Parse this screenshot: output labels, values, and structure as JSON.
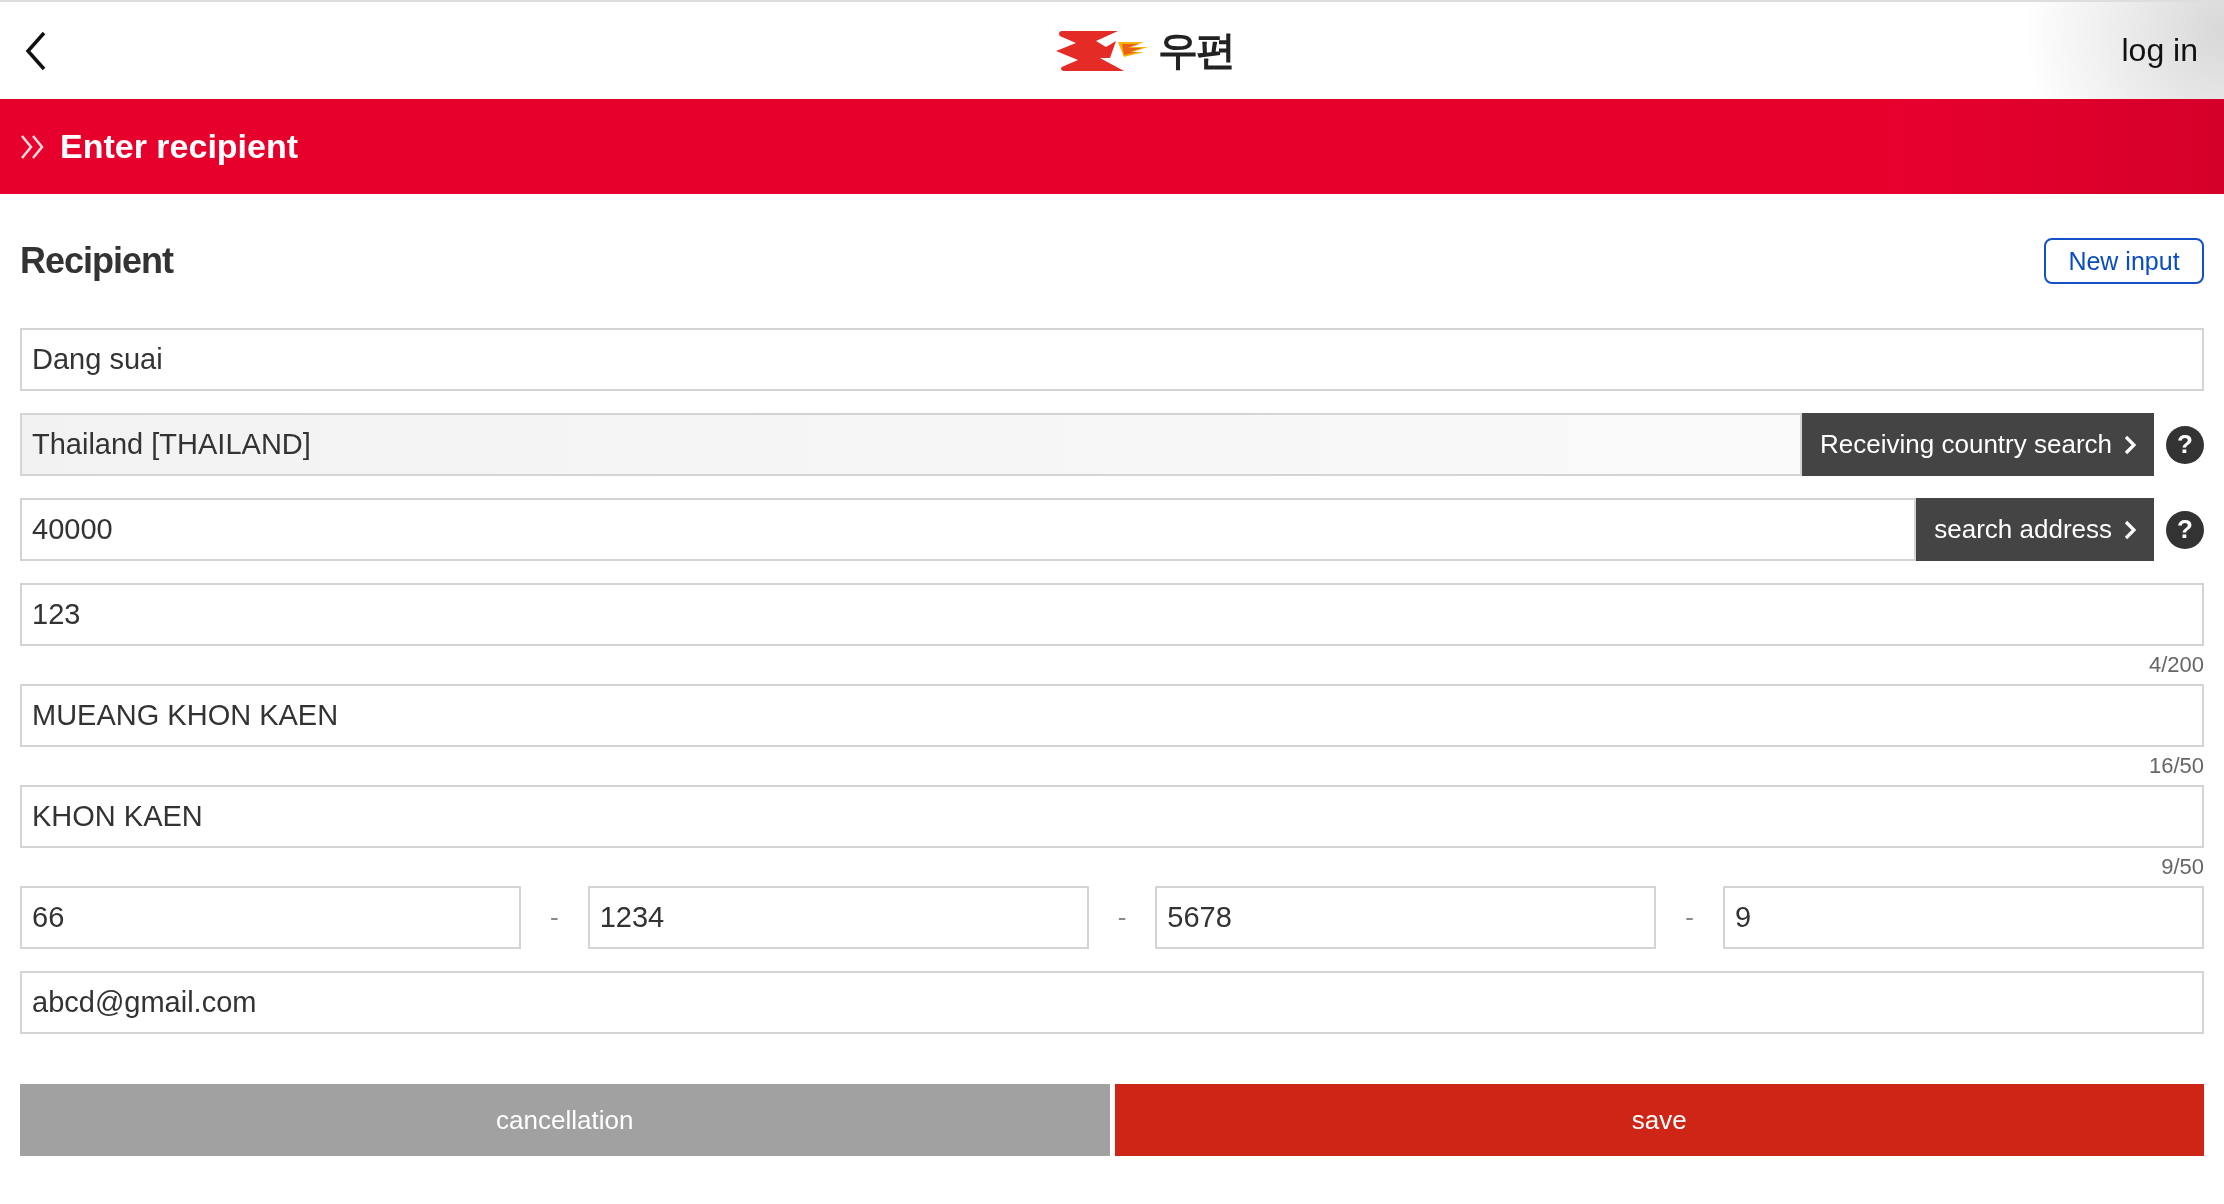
{
  "header": {
    "logo_text": "우편",
    "login": "log in"
  },
  "title_bar": {
    "title": "Enter recipient"
  },
  "section": {
    "title": "Recipient",
    "new_input": "New input"
  },
  "fields": [
    {
      "kind": "text",
      "value": "Dang suai"
    },
    {
      "kind": "search",
      "value": "Thailand [THAILAND]",
      "readonly": true,
      "button": "Receiving country search",
      "help": "?"
    },
    {
      "kind": "search",
      "value": "40000",
      "readonly": false,
      "button": "search address",
      "help": "?"
    },
    {
      "kind": "counted",
      "value": "123",
      "counter": "4/200"
    },
    {
      "kind": "counted",
      "value": "MUEANG KHON KAEN",
      "counter": "16/50"
    },
    {
      "kind": "counted",
      "value": "KHON KAEN",
      "counter": "9/50"
    },
    {
      "kind": "phone",
      "parts": [
        "66",
        "1234",
        "5678",
        "9"
      ],
      "separators": [
        "-",
        "-",
        "-"
      ]
    },
    {
      "kind": "text",
      "value": "abcd@gmail.com"
    }
  ],
  "actions": [
    {
      "kind": "cancel",
      "label": "cancellation"
    },
    {
      "kind": "save",
      "label": "save"
    }
  ]
}
